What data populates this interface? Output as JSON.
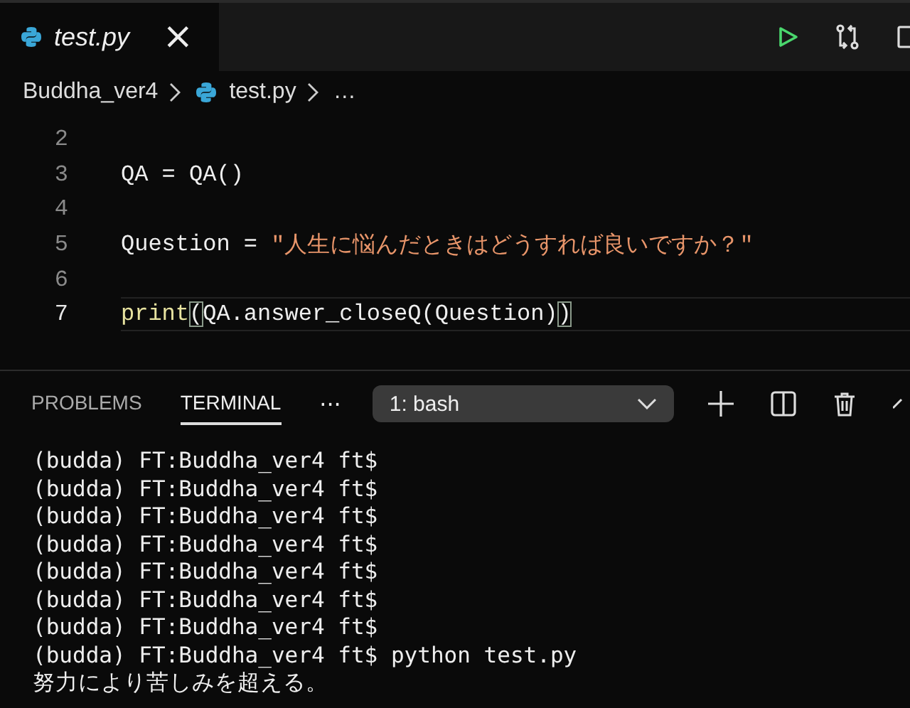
{
  "editor_tab": {
    "label": "test.py",
    "selected": true,
    "close": "×"
  },
  "breadcrumb": [
    {
      "label": "Buddha_ver4",
      "icon": false
    },
    {
      "label": "test.py",
      "icon": true
    },
    {
      "label": "…",
      "icon": false
    }
  ],
  "code_lines": [
    {
      "number": "2",
      "current": false
    },
    {
      "number": "3",
      "current": false,
      "tokens": [
        {
          "text": "QA = QA()",
          "kind": "plain"
        }
      ]
    },
    {
      "number": "4",
      "current": false
    },
    {
      "number": "5",
      "current": false,
      "tokens": [
        {
          "text": "Question = ",
          "kind": "plain"
        },
        {
          "text": "\"人生に悩んだときはどうすれば良いですか？\"",
          "kind": "string"
        }
      ]
    },
    {
      "number": "6",
      "current": false
    },
    {
      "number": "7",
      "current": true,
      "tokens": [
        {
          "text": "print",
          "kind": "function"
        },
        {
          "text": "(",
          "kind": "bracket"
        },
        {
          "text": "QA.answer_closeQ(Question)",
          "kind": "plain"
        },
        {
          "text": ")",
          "kind": "bracket"
        }
      ]
    }
  ],
  "panel_tabs": [
    {
      "label": "PROBLEMS",
      "selected": false
    },
    {
      "label": "TERMINAL",
      "selected": true
    }
  ],
  "more": "···",
  "terminal_select": {
    "value": "1: bash"
  },
  "terminal_lines": [
    "(budda) FT:Buddha_ver4 ft$",
    "(budda) FT:Buddha_ver4 ft$",
    "(budda) FT:Buddha_ver4 ft$",
    "(budda) FT:Buddha_ver4 ft$",
    "(budda) FT:Buddha_ver4 ft$",
    "(budda) FT:Buddha_ver4 ft$",
    "(budda) FT:Buddha_ver4 ft$",
    "(budda) FT:Buddha_ver4 ft$ python test.py",
    "努力により苦しみを超える。"
  ]
}
